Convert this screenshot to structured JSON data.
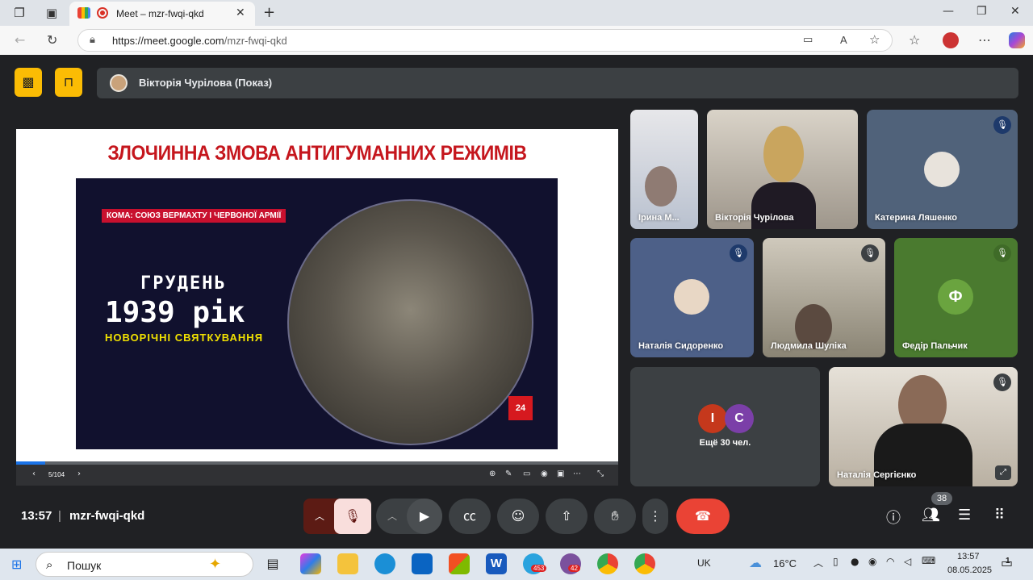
{
  "browser": {
    "tab_title": "Meet – mzr-fwqi-qkd",
    "url_host": "https://meet.google.com",
    "url_path": "/mzr-fwqi-qkd"
  },
  "meet": {
    "presenter_label": "Вікторія Чурілова (Показ)",
    "slide": {
      "title": "ЗЛОЧИННА ЗМОВА АНТИГУМАННИХ РЕЖИМІВ",
      "video_tag": "КОМА: СОЮЗ ВЕРМАХТУ І ЧЕРВОНОЇ АРМІЇ",
      "video_month": "ГРУДЕНЬ",
      "video_year": "1939 рік",
      "video_subtitle": "НОВОРІЧНІ СВЯТКУВАННЯ",
      "video_logo": "24",
      "page_count": "5/104",
      "progress": 0.048
    },
    "participants": [
      {
        "name": "Ірина М..."
      },
      {
        "name": "Вікторія Чурілова"
      },
      {
        "name": "Катерина Ляшенко"
      },
      {
        "name": "Наталія Сидоренко"
      },
      {
        "name": "Людмила Шуліка"
      },
      {
        "name": "Федір Пальчик",
        "initial": "Ф"
      },
      {
        "name": "Наталія Сергієнко"
      }
    ],
    "more_tile": {
      "label": "Ещё 30 чел.",
      "initials": [
        "I",
        "C"
      ]
    },
    "meeting_time": "13:57",
    "meeting_code": "mzr-fwqi-qkd",
    "participants_count": "38"
  },
  "taskbar": {
    "search_placeholder": "Пошук",
    "layout": "UK",
    "temperature": "16°C",
    "clock_time": "13:57",
    "clock_date": "08.05.2025",
    "telegram_badge": "453",
    "viber_badge": "42",
    "notification_count": "1"
  }
}
